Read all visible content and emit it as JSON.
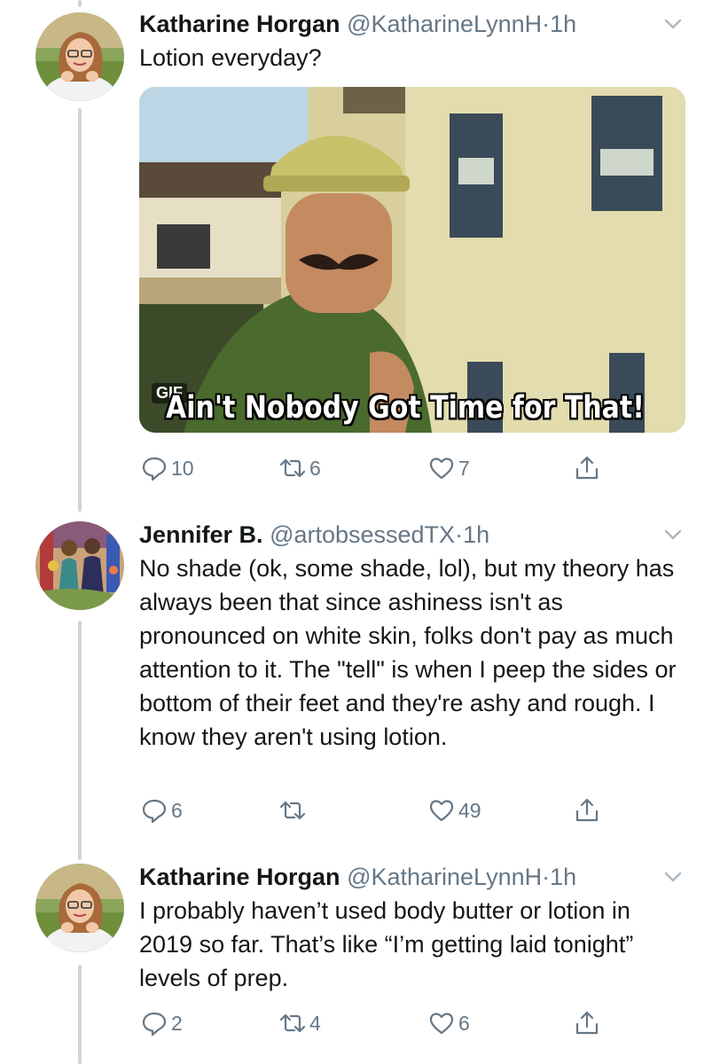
{
  "tweets": [
    {
      "name": "Katharine Horgan",
      "handle": "@KatharineLynnH",
      "dot": "·",
      "time": "1h",
      "text": "Lotion everyday?",
      "media": {
        "badge": "GIF",
        "caption": "Ain't Nobody Got Time for That!"
      },
      "replies": "10",
      "retweets": "6",
      "likes": "7"
    },
    {
      "name": "Jennifer B.",
      "handle": "@artobsessedTX",
      "dot": "·",
      "time": "1h",
      "text": "No shade (ok, some shade, lol), but my theory has always been that since ashiness isn't as pronounced on white skin, folks don't pay as much attention to it. The \"tell\" is when I peep the sides or bottom of their feet and they're ashy and rough. I know they aren't using lotion.",
      "replies": "6",
      "retweets": "",
      "likes": "49"
    },
    {
      "name": "Katharine Horgan",
      "handle": "@KatharineLynnH",
      "dot": "·",
      "time": "1h",
      "text": "I probably haven’t used body butter or lotion in 2019 so far. That’s like “I’m getting laid tonight” levels of prep.",
      "replies": "2",
      "retweets": "4",
      "likes": "6"
    }
  ],
  "icons": {
    "reply": "reply-icon",
    "retweet": "retweet-icon",
    "like": "heart-icon",
    "share": "share-icon",
    "more": "chevron-down-icon"
  },
  "colors": {
    "text": "#14171a",
    "secondary": "#657786",
    "thread": "#ccd6dd"
  }
}
